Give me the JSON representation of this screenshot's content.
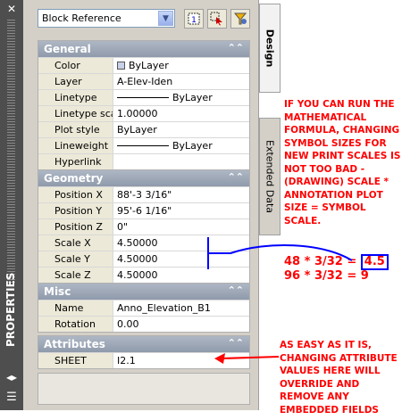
{
  "palette": {
    "title": "PROPERTIES",
    "close_glyph": "✕",
    "toggle_glyph": "◂▸",
    "menu_glyph": "☰",
    "selection": "Block Reference",
    "toolbar": {
      "quick_select_icon": "quick-select-icon",
      "select_objects_icon": "select-objects-icon",
      "pickadd_icon": "pickadd-toggle-icon"
    },
    "tabs": {
      "design": "Design",
      "extended": "Extended Data"
    },
    "collapse_glyph": "⌃⌃",
    "sections": {
      "general": {
        "title": "General",
        "rows": [
          {
            "name": "Color",
            "value": "ByLayer"
          },
          {
            "name": "Layer",
            "value": "A-Elev-Iden"
          },
          {
            "name": "Linetype",
            "value": "ByLayer"
          },
          {
            "name": "Linetype scale",
            "value": "1.00000"
          },
          {
            "name": "Plot style",
            "value": "ByLayer"
          },
          {
            "name": "Lineweight",
            "value": "ByLayer"
          },
          {
            "name": "Hyperlink",
            "value": ""
          }
        ]
      },
      "geometry": {
        "title": "Geometry",
        "rows": [
          {
            "name": "Position X",
            "value": "88'-3 3/16\""
          },
          {
            "name": "Position Y",
            "value": "95'-6 1/16\""
          },
          {
            "name": "Position Z",
            "value": "0\""
          },
          {
            "name": "Scale X",
            "value": "4.50000"
          },
          {
            "name": "Scale Y",
            "value": "4.50000"
          },
          {
            "name": "Scale Z",
            "value": "4.50000"
          }
        ]
      },
      "misc": {
        "title": "Misc",
        "rows": [
          {
            "name": "Name",
            "value": "Anno_Elevation_B1"
          },
          {
            "name": "Rotation",
            "value": "0.00"
          }
        ]
      },
      "attributes": {
        "title": "Attributes",
        "rows": [
          {
            "name": "SHEET",
            "value": "I2.1"
          }
        ]
      }
    }
  },
  "annotations": {
    "note1": "IF YOU CAN RUN THE MATHEMATICAL FORMULA, CHANGING SYMBOL SIZES FOR NEW PRINT SCALES IS NOT TOO BAD - (DRAWING) SCALE * ANNOTATION PLOT SIZE = SYMBOL SCALE.",
    "eq1_prefix": "48 * 3/32 = ",
    "eq1_result": "4.5",
    "eq2": "96 * 3/32 = 9",
    "note2": "AS EASY AS IT IS, CHANGING ATTRIBUTE VALUES HERE WILL OVERRIDE AND REMOVE ANY EMBEDDED FIELDS",
    "colors": {
      "note": "#ff0000",
      "highlight": "#0000ff"
    }
  }
}
